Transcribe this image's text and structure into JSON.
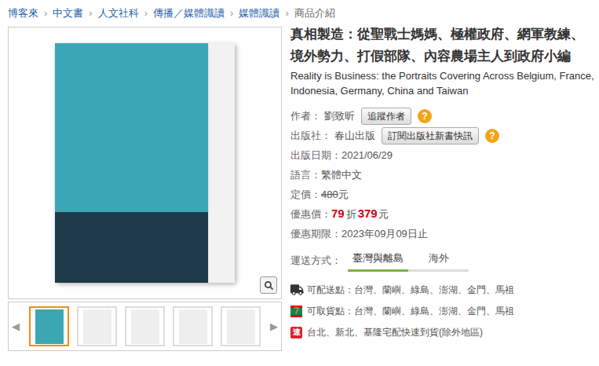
{
  "breadcrumb": {
    "separator": "›",
    "items": [
      {
        "label": "博客來",
        "current": false
      },
      {
        "label": "中文書",
        "current": false
      },
      {
        "label": "人文社科",
        "current": false
      },
      {
        "label": "傳播／媒體識讀",
        "current": false
      },
      {
        "label": "媒體識讀",
        "current": false
      },
      {
        "label": "商品介紹",
        "current": true
      }
    ]
  },
  "gallery": {
    "prev": "◀",
    "next": "▶",
    "thumbnails": [
      {
        "selected": true
      },
      {
        "selected": false
      },
      {
        "selected": false
      },
      {
        "selected": false
      },
      {
        "selected": false
      }
    ]
  },
  "product": {
    "title": "真相製造：從聖戰士媽媽、極權政府、網軍教練、境外勢力、打假部隊、內容農場主人到政府小編",
    "subtitle": "Reality is Business: the Portraits Covering Across Belgium, France, Indonesia, Germany, China and Taiwan",
    "fields": [
      {
        "kind": "button",
        "label": "作者：",
        "value": "劉致昕",
        "button": "追蹤作者",
        "help": "?"
      },
      {
        "kind": "button",
        "label": "出版社：",
        "value": "春山出版",
        "button": "訂閱出版社新書快訊",
        "help": "?"
      },
      {
        "kind": "plain",
        "label": "出版日期：",
        "value": "2021/06/29"
      },
      {
        "kind": "plain",
        "label": "語言：",
        "value": "繁體中文"
      },
      {
        "kind": "strike",
        "label": "定價：",
        "value": "480",
        "unit": "元"
      },
      {
        "kind": "sale",
        "label": "優惠價：",
        "discount": "79",
        "discount_unit": "折",
        "value": "379",
        "unit": "元"
      },
      {
        "kind": "plain",
        "label": "優惠期限：",
        "value": "2023年09月09日止"
      }
    ]
  },
  "shipping": {
    "label": "運送方式：",
    "tabs": [
      {
        "label": "臺灣與離島",
        "selected": true
      },
      {
        "label": "海外",
        "selected": false
      }
    ],
    "destinations": [
      {
        "kind": "truck",
        "label": "可配送點：",
        "value": "台灣、蘭嶼、綠島、澎湖、金門、馬祖"
      },
      {
        "kind": "store",
        "icon_text": "7",
        "label": "可取貨點：",
        "value": "台灣、蘭嶼、綠島、澎湖、金門、馬祖"
      },
      {
        "kind": "express",
        "icon_text": "速",
        "label": "",
        "value": "台北、新北、基隆宅配快速到貨(除外地區)"
      }
    ]
  }
}
